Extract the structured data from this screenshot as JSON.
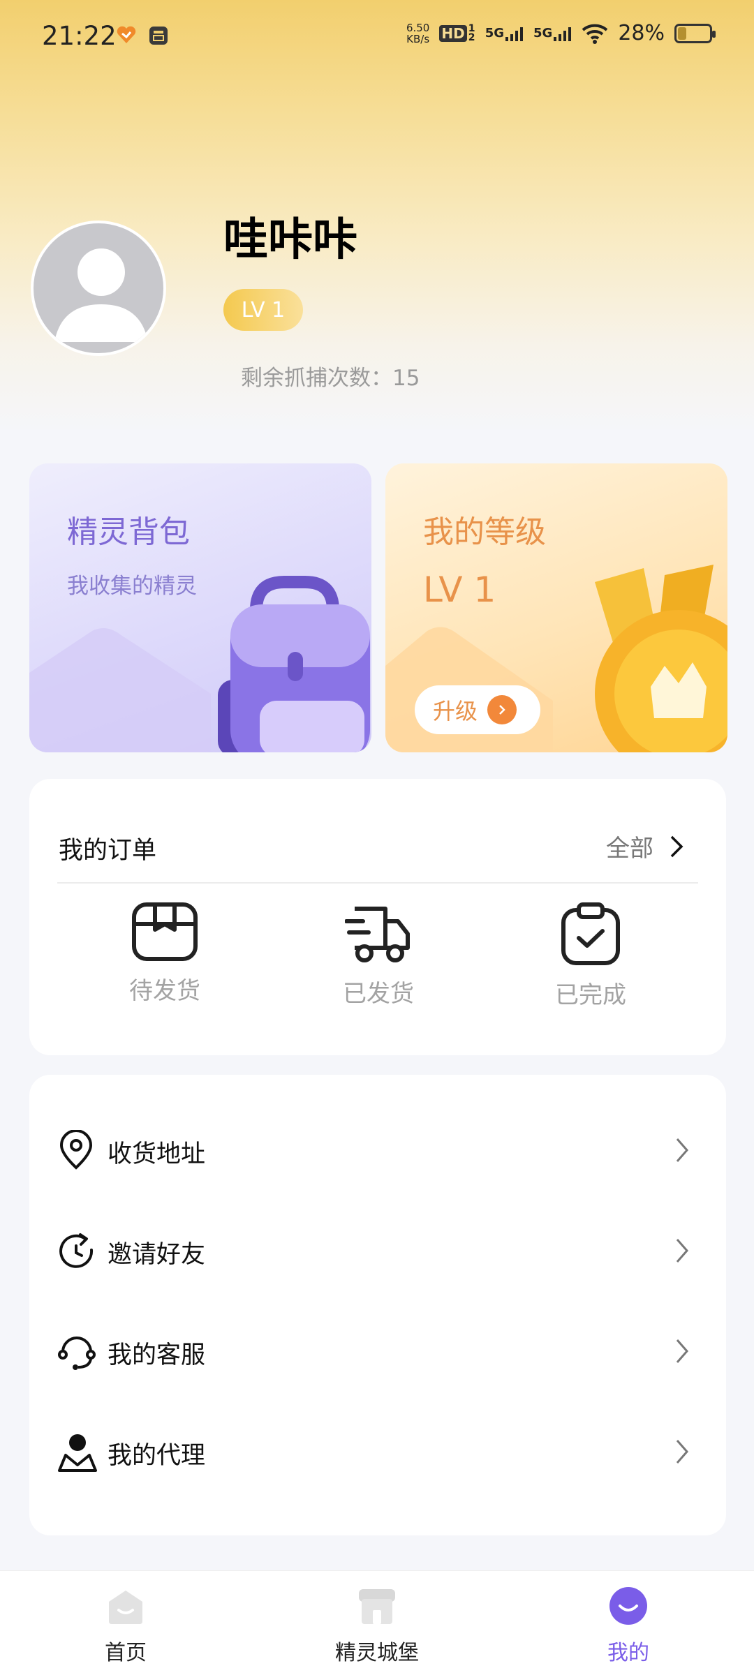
{
  "status_bar": {
    "time": "21:22",
    "net_speed_value": "6.50",
    "net_speed_unit": "KB/s",
    "hd_tag": "HD",
    "hd_sub": "1 2",
    "sig1": "5G",
    "sig2": "5G",
    "battery": "28%",
    "battery_level": 0.28
  },
  "profile": {
    "username": "哇咔咔",
    "level_badge": "LV 1",
    "remaining_label": "剩余抓捕次数：15"
  },
  "cards": {
    "bag": {
      "title": "精灵背包",
      "subtitle": "我收集的精灵"
    },
    "level": {
      "title": "我的等级",
      "value": "LV 1",
      "upgrade": "升级"
    }
  },
  "orders": {
    "title": "我的订单",
    "all": "全部",
    "items": [
      {
        "label": "待发货",
        "icon": "box-icon"
      },
      {
        "label": "已发货",
        "icon": "truck-icon"
      },
      {
        "label": "已完成",
        "icon": "clipboard-check-icon"
      }
    ]
  },
  "menu": {
    "items": [
      {
        "label": "收货地址",
        "icon": "location-pin-icon"
      },
      {
        "label": "邀请好友",
        "icon": "refresh-arrow-icon"
      },
      {
        "label": "我的客服",
        "icon": "headset-icon"
      },
      {
        "label": "我的代理",
        "icon": "person-icon"
      }
    ]
  },
  "bottom_nav": {
    "items": [
      {
        "label": "首页",
        "icon": "home-icon",
        "active": false
      },
      {
        "label": "精灵城堡",
        "icon": "shop-icon",
        "active": false
      },
      {
        "label": "我的",
        "icon": "me-icon",
        "active": true
      }
    ]
  },
  "colors": {
    "accent_purple": "#7a5de8",
    "accent_orange": "#e8924a",
    "header_gold": "#f2cf6e"
  }
}
